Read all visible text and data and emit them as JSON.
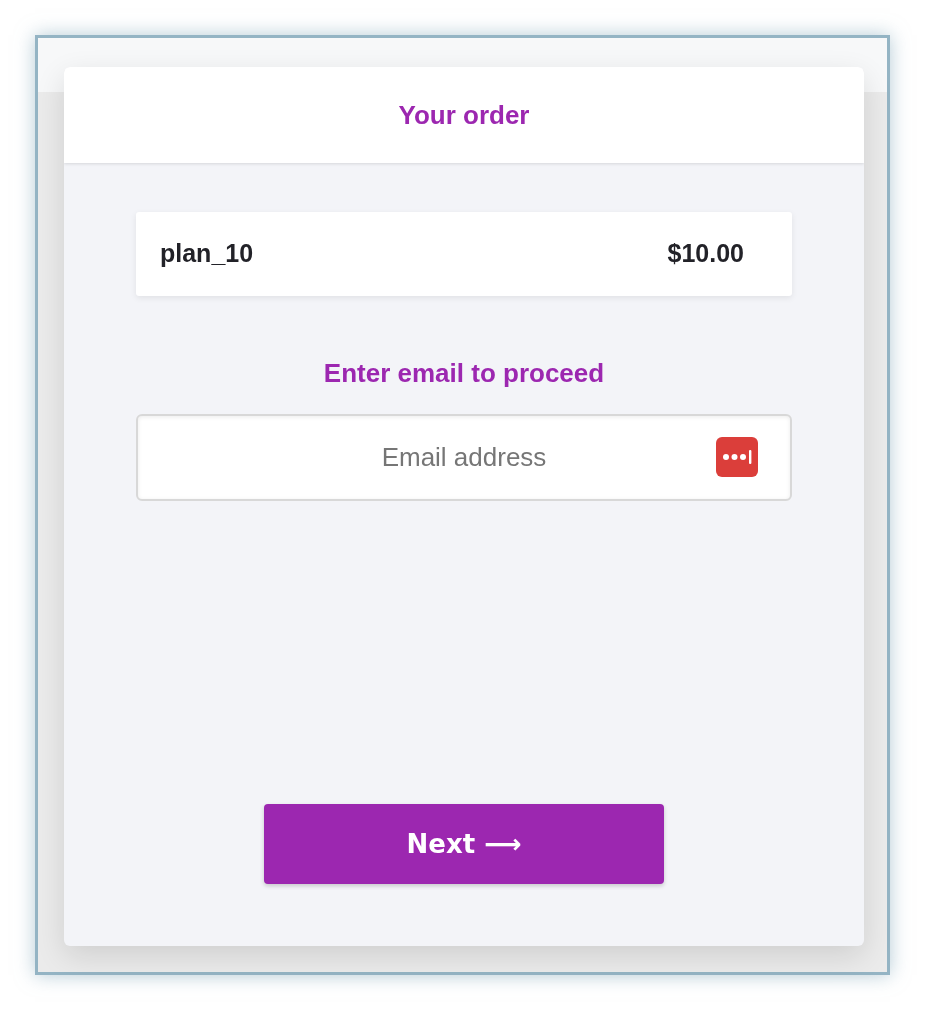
{
  "header": {
    "title": "Your order"
  },
  "order_items": [
    {
      "name": "plan_10",
      "price": "$10.00"
    }
  ],
  "email_section": {
    "heading": "Enter email to proceed",
    "placeholder": "Email address"
  },
  "next_button": {
    "label": "Next ⟶"
  }
}
